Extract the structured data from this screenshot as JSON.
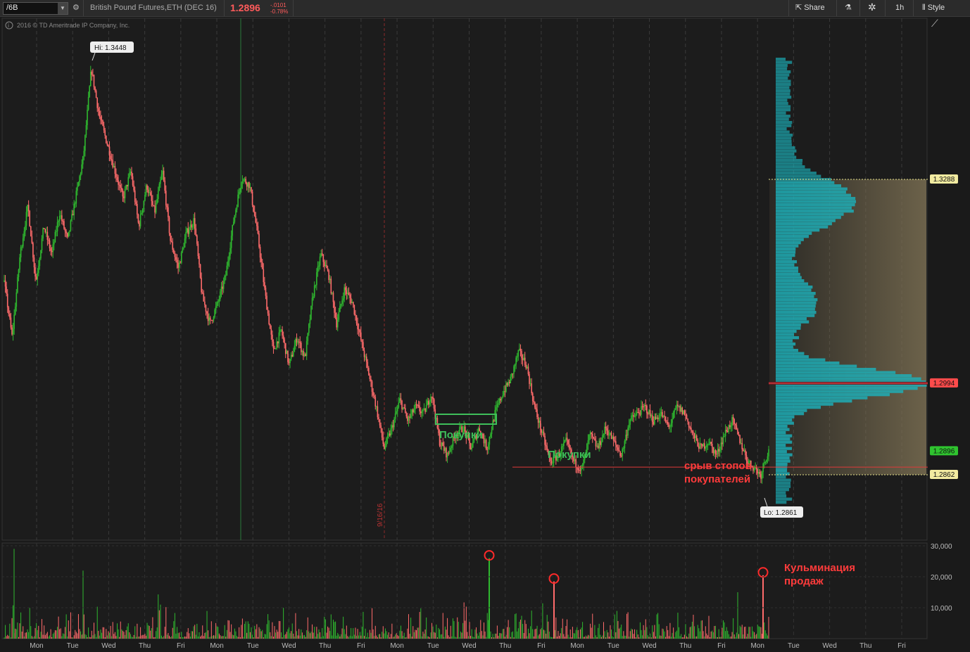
{
  "toolbar": {
    "symbol": "/6B",
    "title": "British Pound Futures,ETH (DEC 16)",
    "price": "1.2896",
    "change_abs": "-.0101",
    "change_pct": "-0.78%",
    "share_label": "Share",
    "timeframe_label": "1h",
    "style_label": "Style"
  },
  "copyright": "2016 © TD Ameritrade IP Company, Inc.",
  "colors": {
    "up": "#2fb82f",
    "down": "#ff6b6b",
    "profile": "#1bb3bd",
    "value_area": "#7a6e52"
  },
  "chart_data": [
    {
      "type": "candlestick",
      "title": "British Pound Futures,ETH (DEC 16)",
      "timeframe": "1h",
      "ylim": [
        1.28,
        1.35
      ],
      "x_tick_labels": [
        "Mon",
        "Tue",
        "Wed",
        "Thu",
        "Fri",
        "Mon",
        "Tue",
        "Wed",
        "Thu",
        "Fri",
        "Mon",
        "Tue",
        "Wed",
        "Thu",
        "Fri",
        "Mon",
        "Tue",
        "Wed",
        "Thu",
        "Fri",
        "Mon",
        "Tue",
        "Wed",
        "Thu",
        "Fri"
      ],
      "price_path": [
        [
          0,
          1.314
        ],
        [
          5,
          1.306
        ],
        [
          10,
          1.318
        ],
        [
          15,
          1.325
        ],
        [
          20,
          1.314
        ],
        [
          25,
          1.322
        ],
        [
          30,
          1.318
        ],
        [
          35,
          1.324
        ],
        [
          40,
          1.32
        ],
        [
          45,
          1.326
        ],
        [
          50,
          1.332
        ],
        [
          55,
          1.3448
        ],
        [
          60,
          1.338
        ],
        [
          65,
          1.334
        ],
        [
          70,
          1.33
        ],
        [
          75,
          1.326
        ],
        [
          80,
          1.33
        ],
        [
          85,
          1.322
        ],
        [
          90,
          1.328
        ],
        [
          95,
          1.324
        ],
        [
          100,
          1.33
        ],
        [
          105,
          1.32
        ],
        [
          110,
          1.316
        ],
        [
          115,
          1.321
        ],
        [
          120,
          1.323
        ],
        [
          125,
          1.312
        ],
        [
          130,
          1.308
        ],
        [
          135,
          1.311
        ],
        [
          140,
          1.315
        ],
        [
          145,
          1.323
        ],
        [
          150,
          1.329
        ],
        [
          155,
          1.328
        ],
        [
          160,
          1.321
        ],
        [
          165,
          1.312
        ],
        [
          170,
          1.304
        ],
        [
          175,
          1.307
        ],
        [
          180,
          1.302
        ],
        [
          185,
          1.306
        ],
        [
          190,
          1.303
        ],
        [
          195,
          1.312
        ],
        [
          200,
          1.318
        ],
        [
          205,
          1.315
        ],
        [
          210,
          1.308
        ],
        [
          215,
          1.313
        ],
        [
          220,
          1.311
        ],
        [
          225,
          1.306
        ],
        [
          230,
          1.301
        ],
        [
          235,
          1.296
        ],
        [
          240,
          1.29
        ],
        [
          245,
          1.293
        ],
        [
          250,
          1.297
        ],
        [
          255,
          1.294
        ],
        [
          260,
          1.296
        ],
        [
          265,
          1.295
        ],
        [
          270,
          1.298
        ],
        [
          275,
          1.291
        ],
        [
          280,
          1.289
        ],
        [
          285,
          1.292
        ],
        [
          290,
          1.293
        ],
        [
          295,
          1.29
        ],
        [
          300,
          1.293
        ],
        [
          305,
          1.29
        ],
        [
          310,
          1.295
        ],
        [
          315,
          1.298
        ],
        [
          320,
          1.3
        ],
        [
          325,
          1.304
        ],
        [
          330,
          1.302
        ],
        [
          335,
          1.296
        ],
        [
          340,
          1.292
        ],
        [
          345,
          1.288
        ],
        [
          350,
          1.289
        ],
        [
          355,
          1.291
        ],
        [
          360,
          1.288
        ],
        [
          365,
          1.287
        ],
        [
          370,
          1.292
        ],
        [
          375,
          1.29
        ],
        [
          380,
          1.293
        ],
        [
          385,
          1.291
        ],
        [
          390,
          1.289
        ],
        [
          395,
          1.294
        ],
        [
          400,
          1.295
        ],
        [
          405,
          1.296
        ],
        [
          410,
          1.294
        ],
        [
          415,
          1.295
        ],
        [
          420,
          1.293
        ],
        [
          425,
          1.296
        ],
        [
          430,
          1.295
        ],
        [
          435,
          1.292
        ],
        [
          440,
          1.29
        ],
        [
          445,
          1.291
        ],
        [
          450,
          1.289
        ],
        [
          455,
          1.292
        ],
        [
          460,
          1.294
        ],
        [
          465,
          1.291
        ],
        [
          470,
          1.288
        ],
        [
          475,
          1.287
        ],
        [
          478,
          1.2861
        ],
        [
          480,
          1.288
        ],
        [
          483,
          1.2896
        ]
      ],
      "path_x_domain": [
        0,
        483
      ],
      "hi_label": "Hi: 1.3448",
      "lo_label": "Lo: 1.2861",
      "date_markers": [
        "9/16/16"
      ],
      "price_levels": [
        {
          "label": "1.3288",
          "value": 1.3288,
          "kind": "value-area-high"
        },
        {
          "label": "1.2994",
          "value": 1.2994,
          "kind": "point-of-control"
        },
        {
          "label": "1.2896",
          "value": 1.2896,
          "kind": "last"
        },
        {
          "label": "1.2862",
          "value": 1.2862,
          "kind": "value-area-low"
        }
      ],
      "support_line": 1.2873
    },
    {
      "type": "bar",
      "series": "volume",
      "ylim": [
        0,
        30000
      ],
      "y_tick_labels": [
        "30,000",
        "20,000",
        "10,000"
      ],
      "y_ticks": [
        30000,
        20000,
        10000
      ],
      "spikes": [
        26000,
        18500,
        20500
      ]
    }
  ],
  "annotations": {
    "buy1": "Покупки",
    "buy2": "Покупки",
    "stop_run_line1": "срыв стопов",
    "stop_run_line2": "покупателей",
    "climax_line1": "Кульминация",
    "climax_line2": "продаж"
  }
}
